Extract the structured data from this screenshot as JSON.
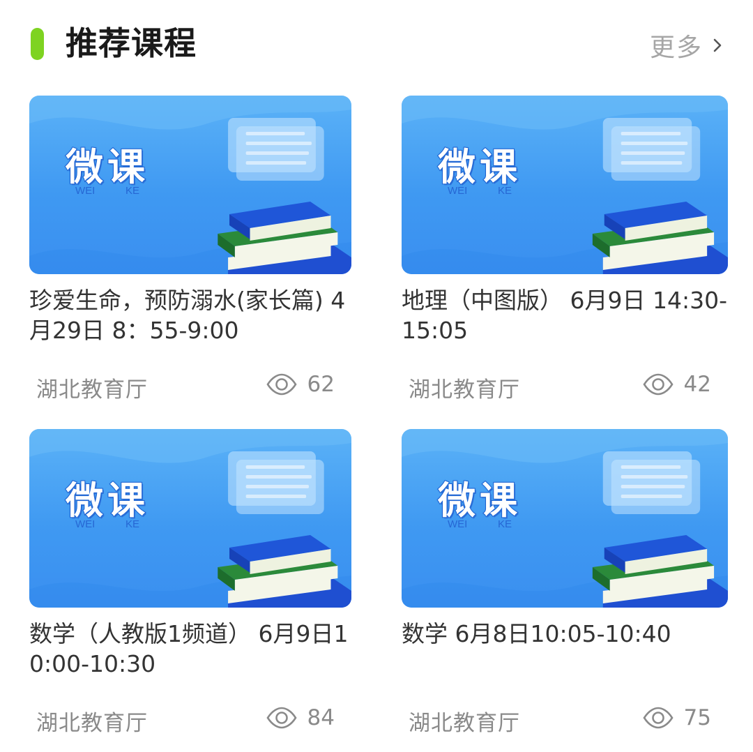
{
  "header": {
    "title": "推荐课程",
    "more_label": "更多",
    "accent_color": "#7ed321"
  },
  "thumbnail": {
    "title": "微课",
    "sub_left": "WEI",
    "sub_right": "KE"
  },
  "courses": [
    {
      "title": "珍爱生命，预防溺水(家长篇) 4月29日 8：55-9:00",
      "source": "湖北教育厅",
      "views": "62"
    },
    {
      "title": "地理（中图版） 6月9日 14:30-15:05",
      "source": "湖北教育厅",
      "views": "42"
    },
    {
      "title": "数学（人教版1频道） 6月9日10:00-10:30",
      "source": "湖北教育厅",
      "views": "84"
    },
    {
      "title": "数学 6月8日10:05-10:40",
      "source": "湖北教育厅",
      "views": "75"
    }
  ],
  "icons": {
    "views": "eye-icon",
    "more": "chevron-right-icon"
  }
}
